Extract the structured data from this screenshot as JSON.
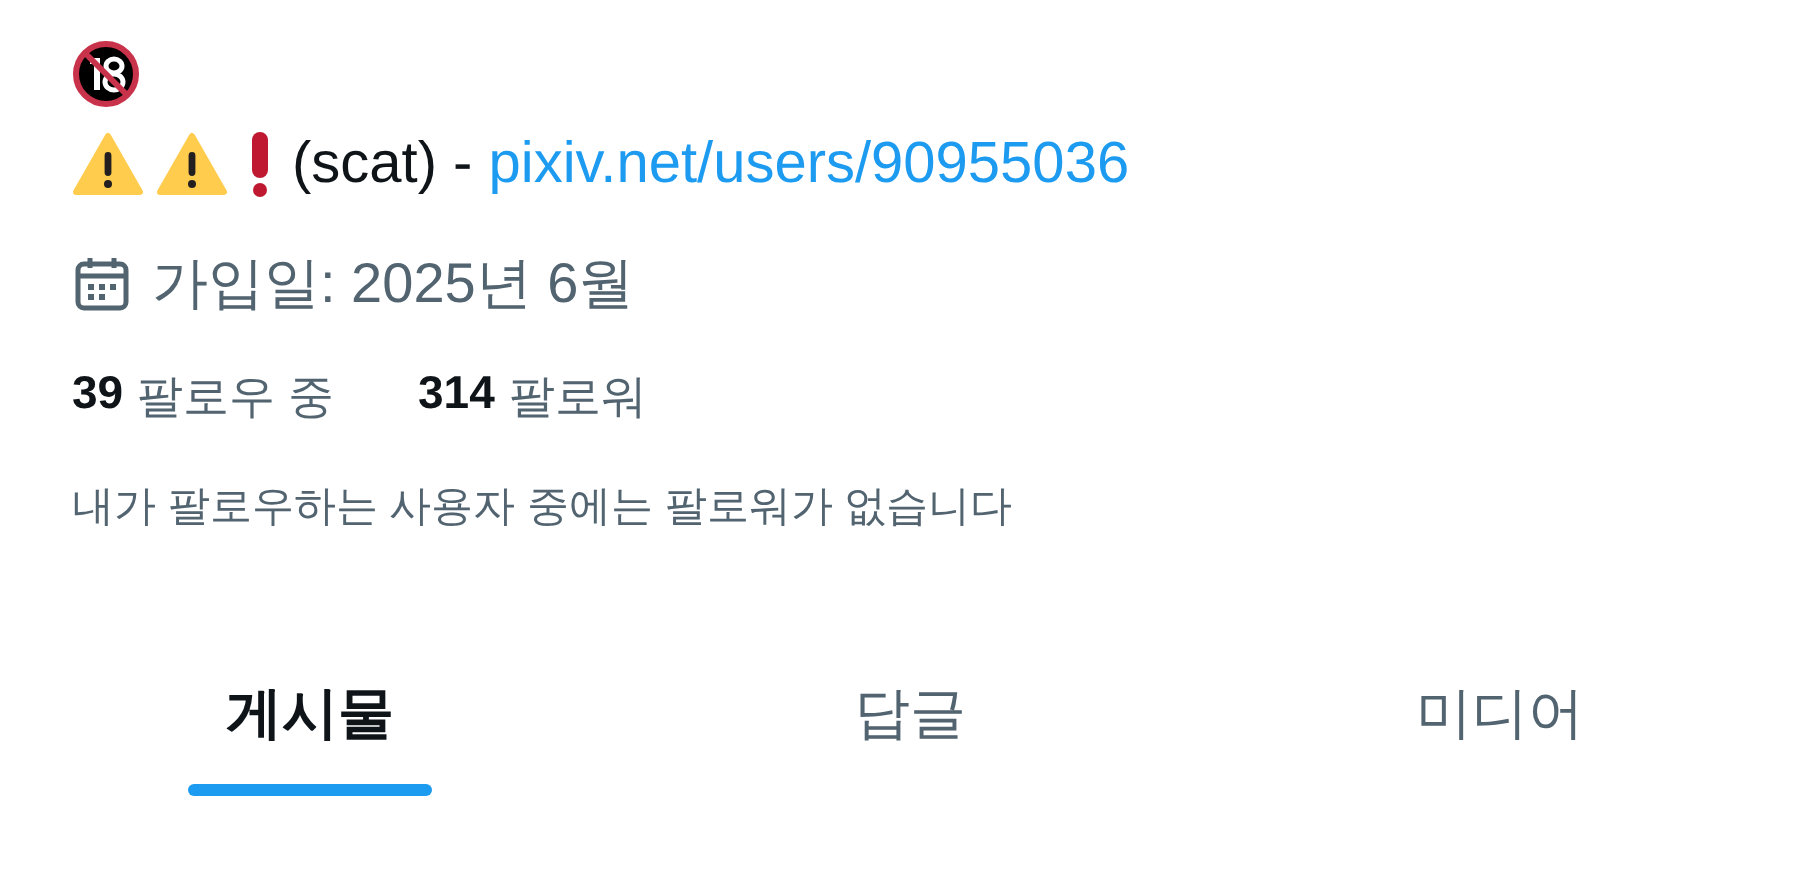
{
  "bio": {
    "text": "(scat) - ",
    "link": "pixiv.net/users/90955036"
  },
  "joined": "가입일: 2025년 6월",
  "stats": [
    {
      "count": "39",
      "label": "팔로우 중"
    },
    {
      "count": "314",
      "label": "팔로워"
    }
  ],
  "followers_note": "내가 팔로우하는 사용자 중에는 팔로워가 없습니다",
  "tabs": [
    {
      "label": "게시물",
      "selected": true
    },
    {
      "label": "답글",
      "selected": false
    },
    {
      "label": "미디어",
      "selected": false
    }
  ]
}
